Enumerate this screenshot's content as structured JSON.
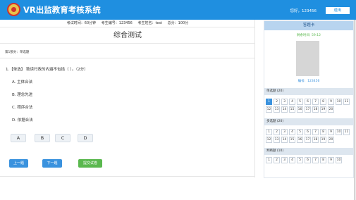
{
  "app": {
    "title": "VR出监教育考核系统",
    "welcome": "您好，123456",
    "logout_label": "退出"
  },
  "exam_info": {
    "duration": "考试时间：60分钟",
    "exam_id": "考生编号：123456",
    "name": "考生姓名：test",
    "total": "总分：100分"
  },
  "exam_title": "综合测试",
  "section_label": "第1部分：单选题",
  "question": {
    "text": "1.【单选】 致读行政的内涵不包括（   ）。（2分）",
    "options": [
      "A. 主体合法",
      "B. 理念先进",
      "C. 程序合法",
      "D. 依据合法"
    ]
  },
  "answer_buttons": [
    "A",
    "B",
    "C",
    "D"
  ],
  "nav": {
    "prev": "上一题",
    "next": "下一题",
    "submit": "提交试卷"
  },
  "answer_sheet": {
    "title": "答题卡",
    "timer": "剩余时间: 59:12",
    "code": "编号：123456",
    "groups": [
      {
        "title": "单选题 (20)",
        "numbers": [
          "1",
          "2",
          "3",
          "4",
          "5",
          "6",
          "7",
          "8",
          "9",
          "10",
          "11",
          "12",
          "13",
          "14",
          "15",
          "16",
          "17",
          "18",
          "19",
          "20"
        ]
      },
      {
        "title": "多选题 (20)",
        "numbers": [
          "1",
          "2",
          "3",
          "4",
          "5",
          "6",
          "7",
          "8",
          "9",
          "10",
          "11",
          "12",
          "13",
          "14",
          "15",
          "16",
          "17",
          "18",
          "19",
          "20"
        ]
      },
      {
        "title": "判断题 (10)",
        "numbers": [
          "1",
          "2",
          "3",
          "4",
          "5",
          "6",
          "7",
          "8",
          "9",
          "10"
        ]
      }
    ]
  },
  "colors": {
    "topbar": "#1f8fe0",
    "primary_button": "#3a92de",
    "submit_button": "#5ab84e",
    "panel_header": "#b8d4ef"
  }
}
